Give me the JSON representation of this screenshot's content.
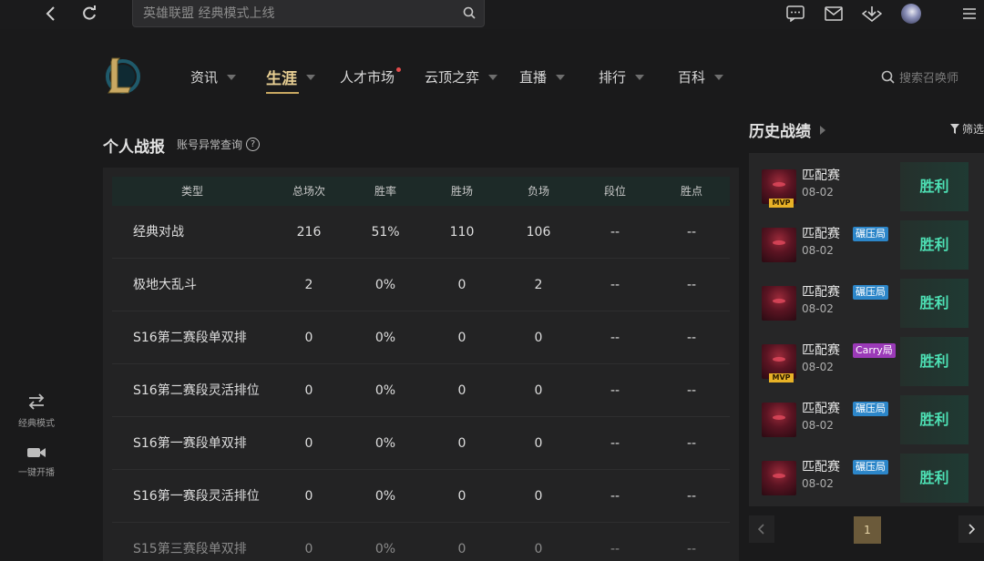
{
  "topbar": {
    "search_placeholder": "英雄联盟 经典模式上线",
    "icons": [
      "back-icon",
      "refresh-icon",
      "search-icon",
      "chat-icon",
      "mail-icon",
      "download-icon",
      "avatar",
      "menu-icon"
    ]
  },
  "sidebar": {
    "tools": [
      {
        "label": "经典模式",
        "icon": "swap-icon"
      },
      {
        "label": "一键开播",
        "icon": "video-camera-icon"
      }
    ]
  },
  "nav": {
    "items": [
      {
        "label": "资讯"
      },
      {
        "label": "生涯"
      },
      {
        "label": "人才市场"
      },
      {
        "label": "云顶之弈"
      },
      {
        "label": "直播"
      },
      {
        "label": "排行"
      },
      {
        "label": "百科"
      }
    ],
    "active_index": 1,
    "search_placeholder": "搜索召唤师"
  },
  "record": {
    "title": "个人战报",
    "link": "账号异常查询",
    "help": "?",
    "headers": [
      "类型",
      "总场次",
      "胜率",
      "胜场",
      "负场",
      "段位",
      "胜点"
    ],
    "rows": [
      [
        "经典对战",
        "216",
        "51%",
        "110",
        "106",
        "--",
        "--"
      ],
      [
        "极地大乱斗",
        "2",
        "0%",
        "0",
        "2",
        "--",
        "--"
      ],
      [
        "S16第二赛段单双排",
        "0",
        "0%",
        "0",
        "0",
        "--",
        "--"
      ],
      [
        "S16第二赛段灵活排位",
        "0",
        "0%",
        "0",
        "0",
        "--",
        "--"
      ],
      [
        "S16第一赛段单双排",
        "0",
        "0%",
        "0",
        "0",
        "--",
        "--"
      ],
      [
        "S16第一赛段灵活排位",
        "0",
        "0%",
        "0",
        "0",
        "--",
        "--"
      ],
      [
        "S15第三赛段单双排",
        "0",
        "0%",
        "0",
        "0",
        "--",
        "--"
      ]
    ]
  },
  "history": {
    "title": "历史战绩",
    "filter": "筛选",
    "matches": [
      {
        "mode": "匹配赛",
        "tag": "",
        "mvp": "MVP",
        "date": "08-02",
        "result": "胜利"
      },
      {
        "mode": "匹配赛",
        "tag": "碾压局",
        "mvp": "",
        "date": "08-02",
        "result": "胜利"
      },
      {
        "mode": "匹配赛",
        "tag": "碾压局",
        "mvp": "",
        "date": "08-02",
        "result": "胜利"
      },
      {
        "mode": "匹配赛",
        "tag": "Carry局",
        "mvp": "MVP",
        "date": "08-02",
        "result": "胜利"
      },
      {
        "mode": "匹配赛",
        "tag": "碾压局",
        "mvp": "",
        "date": "08-02",
        "result": "胜利"
      },
      {
        "mode": "匹配赛",
        "tag": "碾压局",
        "mvp": "",
        "date": "08-02",
        "result": "胜利"
      }
    ],
    "page": "1"
  },
  "colors": {
    "accent_gold": "#c9a862",
    "win_green": "#4de0b4",
    "tag_blue": "#2c86c9",
    "tag_purple": "#9b3ab8",
    "mvp_yellow": "#e8b227"
  }
}
